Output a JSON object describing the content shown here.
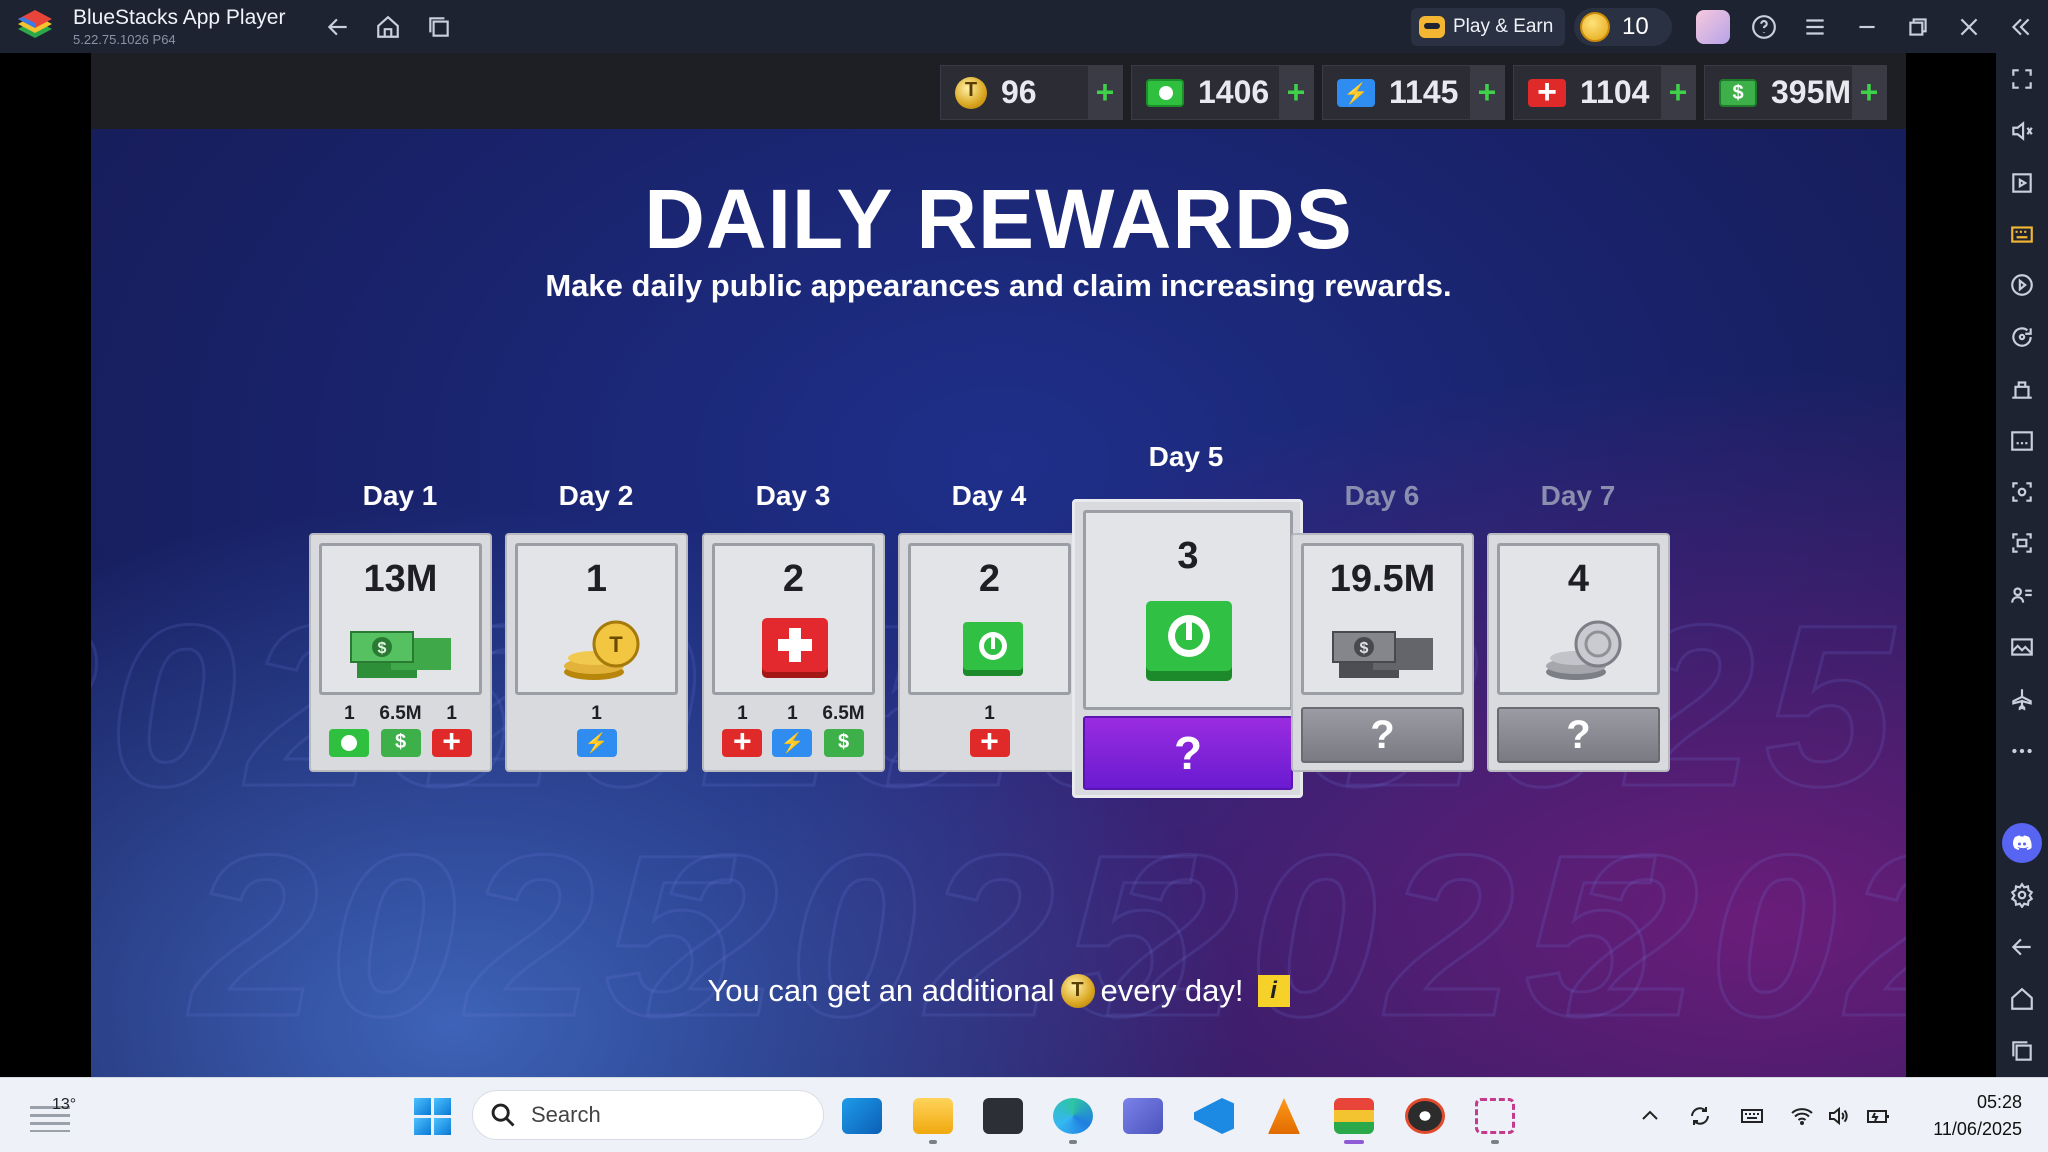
{
  "window": {
    "app_title": "BlueStacks App Player",
    "version": "5.22.75.1026  P64",
    "play_earn_label": "Play & Earn",
    "coin_count": "10"
  },
  "resources": [
    {
      "icon": "ticket-coin-icon",
      "value": "96"
    },
    {
      "icon": "green-vip-icon",
      "value": "1406"
    },
    {
      "icon": "energy-icon",
      "value": "1145"
    },
    {
      "icon": "health-icon",
      "value": "1104"
    },
    {
      "icon": "cash-icon",
      "value": "395M"
    }
  ],
  "rewards": {
    "title": "DAILY REWARDS",
    "subtitle": "Make daily public appearances and claim increasing rewards.",
    "days": [
      {
        "label": "Day 1",
        "amount": "13M",
        "reward": "cash-stack",
        "bonus": [
          {
            "v": "1",
            "icon": "green"
          },
          {
            "v": "6.5M",
            "icon": "cash"
          },
          {
            "v": "1",
            "icon": "red"
          }
        ]
      },
      {
        "label": "Day 2",
        "amount": "1",
        "reward": "gold-coins",
        "bonus": [
          {
            "v": "1",
            "icon": "blue"
          }
        ]
      },
      {
        "label": "Day 3",
        "amount": "2",
        "reward": "health-kit",
        "bonus": [
          {
            "v": "1",
            "icon": "red"
          },
          {
            "v": "1",
            "icon": "blue"
          },
          {
            "v": "6.5M",
            "icon": "cash"
          }
        ]
      },
      {
        "label": "Day 4",
        "amount": "2",
        "reward": "green-vip",
        "bonus": [
          {
            "v": "1",
            "icon": "red"
          }
        ]
      },
      {
        "label": "Day 5",
        "amount": "3",
        "reward": "green-vip",
        "mystery": "?"
      },
      {
        "label": "Day 6",
        "amount": "19.5M",
        "reward": "cash-stack",
        "mystery": "?"
      },
      {
        "label": "Day 7",
        "amount": "4",
        "reward": "silver-coins",
        "mystery": "?"
      }
    ],
    "footer_before": "You can get an additional",
    "footer_after": "every day!",
    "info_label": "i"
  },
  "watermark_text": "2025",
  "taskbar": {
    "temperature": "13°",
    "search_placeholder": "Search",
    "time": "05:28",
    "date": "11/06/2025"
  }
}
